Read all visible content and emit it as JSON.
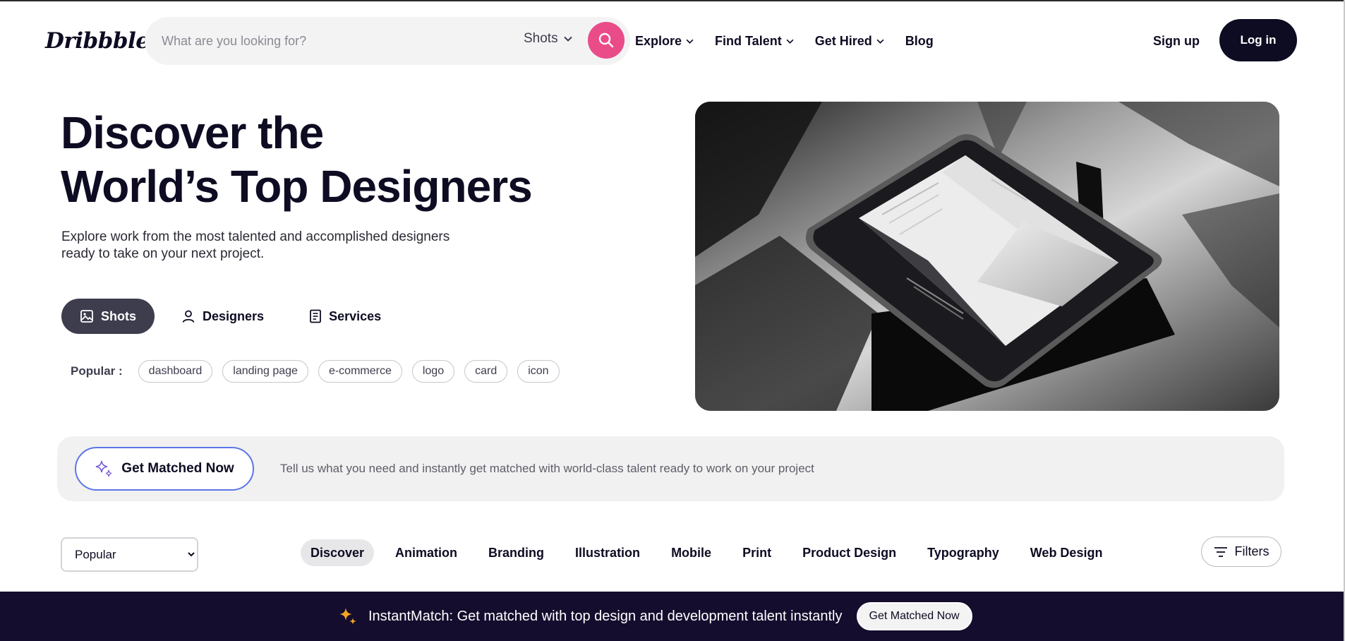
{
  "header": {
    "logo": "Dribbble",
    "search": {
      "placeholder": "What are you looking for?",
      "type": "Shots"
    },
    "nav": [
      {
        "label": "Explore",
        "dropdown": true
      },
      {
        "label": "Find Talent",
        "dropdown": true
      },
      {
        "label": "Get Hired",
        "dropdown": true
      },
      {
        "label": "Blog",
        "dropdown": false
      }
    ],
    "signup": "Sign up",
    "login": "Log in"
  },
  "hero": {
    "title_line1": "Discover the",
    "title_line2": "World’s Top Designers",
    "subtitle": "Explore work from the most talented and accomplished designers ready to take on your next project.",
    "tabs": [
      {
        "label": "Shots",
        "icon": "image-icon",
        "active": true
      },
      {
        "label": "Designers",
        "icon": "person-icon",
        "active": false
      },
      {
        "label": "Services",
        "icon": "document-icon",
        "active": false
      }
    ],
    "popular_label": "Popular :",
    "popular_tags": [
      "dashboard",
      "landing page",
      "e-commerce",
      "logo",
      "card",
      "icon"
    ]
  },
  "matched": {
    "button": "Get Matched Now",
    "text": "Tell us what you need and instantly get matched with world-class talent ready to work on your project"
  },
  "filters": {
    "sort_selected": "Popular",
    "categories": [
      "Discover",
      "Animation",
      "Branding",
      "Illustration",
      "Mobile",
      "Print",
      "Product Design",
      "Typography",
      "Web Design"
    ],
    "active_category": "Discover",
    "filters_button": "Filters"
  },
  "bottom_banner": {
    "text": "InstantMatch: Get matched with top design and development talent instantly",
    "button": "Get Matched Now"
  },
  "colors": {
    "brand_pink": "#ea4c89",
    "dark": "#0d0c22",
    "banner_dark": "#150d2e",
    "accent_blue": "#5b75e8"
  }
}
